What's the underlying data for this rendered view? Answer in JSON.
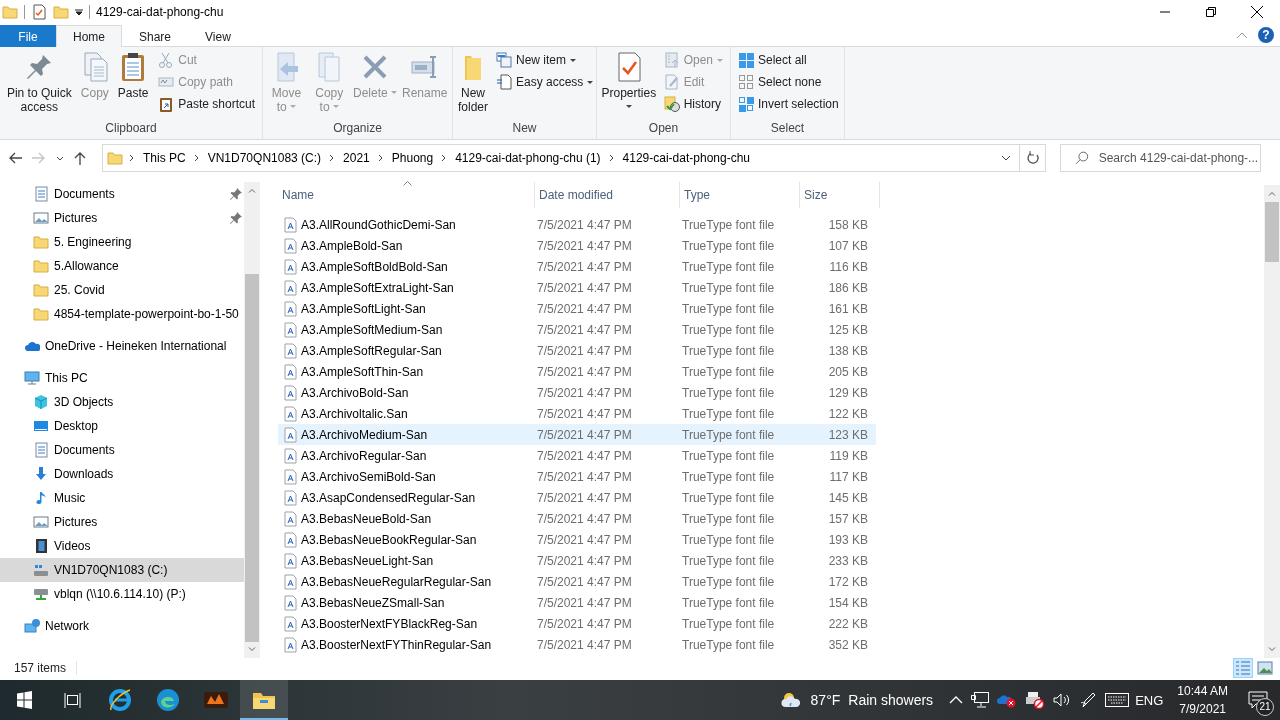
{
  "window": {
    "title": "4129-cai-dat-phong-chu"
  },
  "ribbon": {
    "tabs": [
      {
        "label": "File",
        "kind": "file",
        "selected": false
      },
      {
        "label": "Home",
        "kind": "tab",
        "selected": true
      },
      {
        "label": "Share",
        "kind": "tab",
        "selected": false
      },
      {
        "label": "View",
        "kind": "tab",
        "selected": false
      }
    ],
    "help": "?",
    "groups": [
      {
        "label": "Clipboard",
        "items": [
          {
            "kind": "large",
            "label": "Pin to Quick access",
            "disabled": false,
            "dropdown": false
          },
          {
            "kind": "large",
            "label": "Copy",
            "disabled": true,
            "dropdown": false
          },
          {
            "kind": "large",
            "label": "Paste",
            "disabled": false,
            "dropdown": false
          },
          {
            "kind": "stack",
            "items": [
              {
                "label": "Cut",
                "disabled": true,
                "dropdown": false
              },
              {
                "label": "Copy path",
                "disabled": true,
                "dropdown": false
              },
              {
                "label": "Paste shortcut",
                "disabled": false,
                "dropdown": false
              }
            ]
          }
        ]
      },
      {
        "label": "Organize",
        "items": [
          {
            "kind": "large",
            "label": "Move to",
            "disabled": true,
            "dropdown": true
          },
          {
            "kind": "large",
            "label": "Copy to",
            "disabled": true,
            "dropdown": true
          },
          {
            "kind": "large",
            "label": "Delete",
            "disabled": true,
            "dropdown": true
          },
          {
            "kind": "large",
            "label": "Rename",
            "disabled": true,
            "dropdown": false
          }
        ]
      },
      {
        "label": "New",
        "items": [
          {
            "kind": "large",
            "label": "New folder",
            "disabled": false,
            "dropdown": false
          },
          {
            "kind": "stack",
            "items": [
              {
                "label": "New item",
                "disabled": false,
                "dropdown": true
              },
              {
                "label": "Easy access",
                "disabled": false,
                "dropdown": true
              }
            ]
          }
        ]
      },
      {
        "label": "Open",
        "items": [
          {
            "kind": "large",
            "label": "Properties",
            "disabled": false,
            "dropdown": true
          },
          {
            "kind": "stack",
            "items": [
              {
                "label": "Open",
                "disabled": true,
                "dropdown": true
              },
              {
                "label": "Edit",
                "disabled": true,
                "dropdown": false
              },
              {
                "label": "History",
                "disabled": false,
                "dropdown": false
              }
            ]
          }
        ]
      },
      {
        "label": "Select",
        "items": [
          {
            "kind": "stack",
            "items": [
              {
                "label": "Select all",
                "disabled": false,
                "dropdown": false
              },
              {
                "label": "Select none",
                "disabled": false,
                "dropdown": false
              },
              {
                "label": "Invert selection",
                "disabled": false,
                "dropdown": false
              }
            ]
          }
        ]
      }
    ]
  },
  "address": {
    "nav_buttons": [
      {
        "kind": "back",
        "disabled": false
      },
      {
        "kind": "forward",
        "disabled": true
      },
      {
        "kind": "recent",
        "disabled": false
      },
      {
        "kind": "up",
        "disabled": false
      }
    ],
    "breadcrumbs": [
      "This PC",
      "VN1D70QN1083 (C:)",
      "2021",
      "Phuong",
      "4129-cai-dat-phong-chu (1)",
      "4129-cai-dat-phong-chu"
    ],
    "search": {
      "placeholder": "Search 4129-cai-dat-phong-..."
    }
  },
  "nav_pane": {
    "sections": [
      {
        "items": [
          {
            "children": [
              {
                "label": "Documents",
                "kind": "documents",
                "pinned": true,
                "selected": false
              },
              {
                "label": "Pictures",
                "kind": "pictures",
                "pinned": true,
                "selected": false
              },
              {
                "label": "5. Engineering",
                "kind": "folder",
                "pinned": false,
                "selected": false
              },
              {
                "label": "5.Allowance",
                "kind": "folder",
                "pinned": false,
                "selected": false
              },
              {
                "label": "25. Covid",
                "kind": "folder",
                "pinned": false,
                "selected": false
              },
              {
                "label": "4854-template-powerpoint-bo-1-50",
                "kind": "folder",
                "pinned": false,
                "selected": false
              }
            ]
          }
        ]
      },
      {
        "items": [
          {
            "label": "OneDrive - Heineken International",
            "kind": "onedrive",
            "selected": false
          }
        ]
      },
      {
        "items": [
          {
            "label": "This PC",
            "kind": "pc",
            "selected": false,
            "children": [
              {
                "label": "3D Objects",
                "kind": "objects",
                "selected": false
              },
              {
                "label": "Desktop",
                "kind": "desktop",
                "selected": false
              },
              {
                "label": "Documents",
                "kind": "documents",
                "selected": false
              },
              {
                "label": "Downloads",
                "kind": "downloads",
                "selected": false
              },
              {
                "label": "Music",
                "kind": "music",
                "selected": false
              },
              {
                "label": "Pictures",
                "kind": "pictures",
                "selected": false
              },
              {
                "label": "Videos",
                "kind": "videos",
                "selected": false
              },
              {
                "label": "VN1D70QN1083 (C:)",
                "kind": "drive",
                "selected": true
              },
              {
                "label": "vblqn (\\\\10.6.114.10) (P:)",
                "kind": "netdrive",
                "selected": false
              }
            ]
          }
        ]
      },
      {
        "items": [
          {
            "label": "Network",
            "kind": "network",
            "selected": false
          }
        ]
      }
    ]
  },
  "file_list": {
    "columns": [
      {
        "label": "Name",
        "sorted": true
      },
      {
        "label": "Date modified",
        "sorted": false
      },
      {
        "label": "Type",
        "sorted": false
      },
      {
        "label": "Size",
        "sorted": false
      }
    ],
    "rows": [
      {
        "name": "A3.AllRoundGothicDemi-San",
        "date": "7/5/2021 4:47 PM",
        "type": "TrueType font file",
        "size": "158 KB",
        "highlighted": false
      },
      {
        "name": "A3.AmpleBold-San",
        "date": "7/5/2021 4:47 PM",
        "type": "TrueType font file",
        "size": "107 KB",
        "highlighted": false
      },
      {
        "name": "A3.AmpleSoftBoldBold-San",
        "date": "7/5/2021 4:47 PM",
        "type": "TrueType font file",
        "size": "116 KB",
        "highlighted": false
      },
      {
        "name": "A3.AmpleSoftExtraLight-San",
        "date": "7/5/2021 4:47 PM",
        "type": "TrueType font file",
        "size": "186 KB",
        "highlighted": false
      },
      {
        "name": "A3.AmpleSoftLight-San",
        "date": "7/5/2021 4:47 PM",
        "type": "TrueType font file",
        "size": "161 KB",
        "highlighted": false
      },
      {
        "name": "A3.AmpleSoftMedium-San",
        "date": "7/5/2021 4:47 PM",
        "type": "TrueType font file",
        "size": "125 KB",
        "highlighted": false
      },
      {
        "name": "A3.AmpleSoftRegular-San",
        "date": "7/5/2021 4:47 PM",
        "type": "TrueType font file",
        "size": "138 KB",
        "highlighted": false
      },
      {
        "name": "A3.AmpleSoftThin-San",
        "date": "7/5/2021 4:47 PM",
        "type": "TrueType font file",
        "size": "205 KB",
        "highlighted": false
      },
      {
        "name": "A3.ArchivoBold-San",
        "date": "7/5/2021 4:47 PM",
        "type": "TrueType font file",
        "size": "129 KB",
        "highlighted": false
      },
      {
        "name": "A3.Archivoltalic.San",
        "date": "7/5/2021 4:47 PM",
        "type": "TrueType font file",
        "size": "122 KB",
        "highlighted": false
      },
      {
        "name": "A3.ArchivoMedium-San",
        "date": "7/5/2021 4:47 PM",
        "type": "TrueType font file",
        "size": "123 KB",
        "highlighted": true
      },
      {
        "name": "A3.ArchivoRegular-San",
        "date": "7/5/2021 4:47 PM",
        "type": "TrueType font file",
        "size": "119 KB",
        "highlighted": false
      },
      {
        "name": "A3.ArchivoSemiBold-San",
        "date": "7/5/2021 4:47 PM",
        "type": "TrueType font file",
        "size": "117 KB",
        "highlighted": false
      },
      {
        "name": "A3.AsapCondensedRegular-San",
        "date": "7/5/2021 4:47 PM",
        "type": "TrueType font file",
        "size": "145 KB",
        "highlighted": false
      },
      {
        "name": "A3.BebasNeueBold-San",
        "date": "7/5/2021 4:47 PM",
        "type": "TrueType font file",
        "size": "157 KB",
        "highlighted": false
      },
      {
        "name": "A3.BebasNeueBookRegular-San",
        "date": "7/5/2021 4:47 PM",
        "type": "TrueType font file",
        "size": "193 KB",
        "highlighted": false
      },
      {
        "name": "A3.BebasNeueLight-San",
        "date": "7/5/2021 4:47 PM",
        "type": "TrueType font file",
        "size": "233 KB",
        "highlighted": false
      },
      {
        "name": "A3.BebasNeueRegularRegular-San",
        "date": "7/5/2021 4:47 PM",
        "type": "TrueType font file",
        "size": "172 KB",
        "highlighted": false
      },
      {
        "name": "A3.BebasNeueZSmall-San",
        "date": "7/5/2021 4:47 PM",
        "type": "TrueType font file",
        "size": "154 KB",
        "highlighted": false
      },
      {
        "name": "A3.BoosterNextFYBlackReg-San",
        "date": "7/5/2021 4:47 PM",
        "type": "TrueType font file",
        "size": "222 KB",
        "highlighted": false
      },
      {
        "name": "A3.BoosterNextFYThinRegular-San",
        "date": "7/5/2021 4:47 PM",
        "type": "TrueType font file",
        "size": "352 KB",
        "highlighted": false
      }
    ]
  },
  "status_bar": {
    "count": "157 items",
    "views": [
      {
        "kind": "details",
        "selected": true
      },
      {
        "kind": "large-icons",
        "selected": false
      }
    ]
  },
  "taskbar": {
    "apps": [
      {
        "kind": "start",
        "active": false
      },
      {
        "kind": "task-view",
        "active": false
      },
      {
        "kind": "ie",
        "active": false
      },
      {
        "kind": "edge",
        "active": false
      },
      {
        "kind": "app",
        "active": false
      },
      {
        "kind": "explorer",
        "active": true
      }
    ],
    "weather": {
      "temperature": "87°F",
      "condition": "Rain showers"
    },
    "language": "ENG",
    "time": "10:44 AM",
    "date": "7/9/2021",
    "notifications": "21"
  }
}
